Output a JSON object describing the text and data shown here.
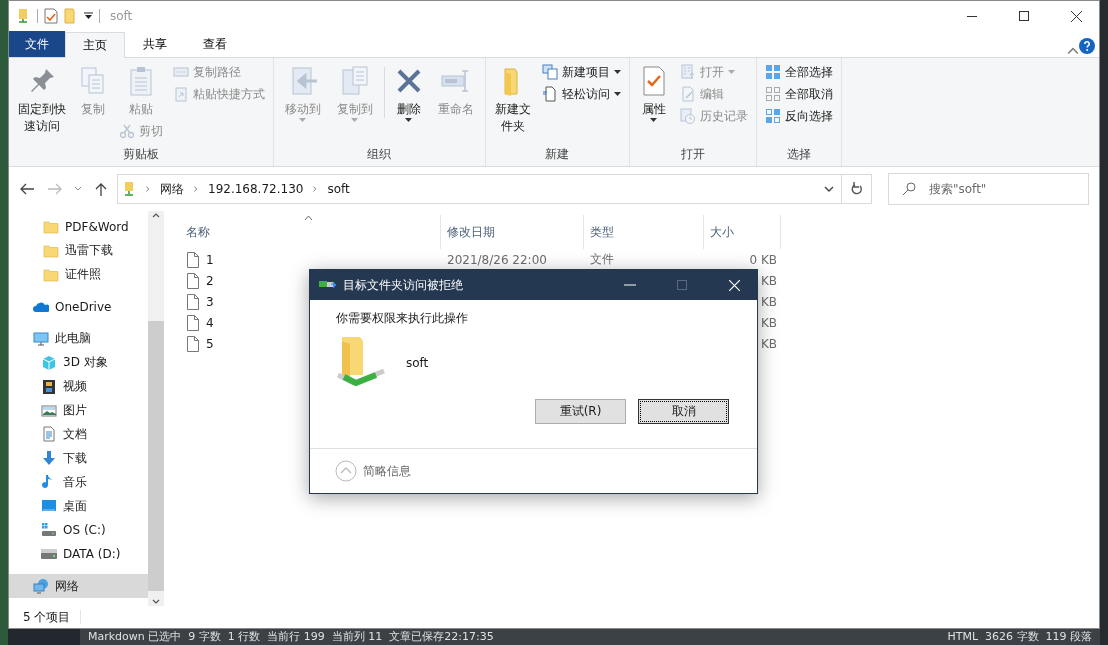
{
  "window": {
    "title": "soft"
  },
  "ribbon": {
    "file_tab": "文件",
    "tabs": [
      {
        "label": "主页",
        "selected": true
      },
      {
        "label": "共享",
        "selected": false
      },
      {
        "label": "查看",
        "selected": false
      }
    ],
    "groups": [
      {
        "label": "剪贴板",
        "columns": [
          [
            {
              "kind": "large",
              "label": "固定到快速访问",
              "disabled": false,
              "menu": false
            }
          ],
          [
            {
              "kind": "large",
              "label": "复制",
              "disabled": true,
              "menu": false
            }
          ],
          [
            {
              "kind": "large",
              "label": "粘贴",
              "disabled": true,
              "menu": false
            },
            {
              "kind": "small",
              "label": "剪切",
              "disabled": true,
              "menu": false
            }
          ],
          [
            {
              "kind": "small",
              "label": "复制路径",
              "disabled": true,
              "menu": false
            },
            {
              "kind": "small",
              "label": "粘贴快捷方式",
              "disabled": true,
              "menu": false
            }
          ]
        ]
      },
      {
        "label": "组织",
        "columns": [
          [
            {
              "kind": "large",
              "label": "移动到",
              "disabled": true,
              "menu": true
            }
          ],
          [
            {
              "kind": "large",
              "label": "复制到",
              "disabled": true,
              "menu": true
            }
          ],
          [
            {
              "kind": "large",
              "label": "删除",
              "disabled": false,
              "menu": true
            }
          ],
          [
            {
              "kind": "large",
              "label": "重命名",
              "disabled": true,
              "menu": false
            }
          ]
        ]
      },
      {
        "label": "新建",
        "columns": [
          [
            {
              "kind": "large",
              "label": "新建文件夹",
              "disabled": false,
              "menu": false
            }
          ],
          [
            {
              "kind": "small",
              "label": "新建项目",
              "disabled": false,
              "menu": true
            },
            {
              "kind": "small",
              "label": "轻松访问",
              "disabled": false,
              "menu": true
            }
          ]
        ]
      },
      {
        "label": "打开",
        "columns": [
          [
            {
              "kind": "large",
              "label": "属性",
              "disabled": false,
              "menu": true
            }
          ],
          [
            {
              "kind": "small",
              "label": "打开",
              "disabled": true,
              "menu": true
            },
            {
              "kind": "small",
              "label": "编辑",
              "disabled": true,
              "menu": false
            },
            {
              "kind": "small",
              "label": "历史记录",
              "disabled": true,
              "menu": false
            }
          ]
        ]
      },
      {
        "label": "选择",
        "columns": [
          [
            {
              "kind": "small",
              "label": "全部选择",
              "disabled": false,
              "menu": false
            },
            {
              "kind": "small",
              "label": "全部取消",
              "disabled": false,
              "menu": false
            },
            {
              "kind": "small",
              "label": "反向选择",
              "disabled": false,
              "menu": false
            }
          ]
        ]
      }
    ]
  },
  "address": {
    "crumbs": [
      "网络",
      "192.168.72.130",
      "soft"
    ]
  },
  "search": {
    "placeholder": "搜索\"soft\""
  },
  "sidebar": {
    "pinned": [
      {
        "label": "PDF&Word",
        "selected": false
      },
      {
        "label": "迅雷下载",
        "selected": false
      },
      {
        "label": "证件照",
        "selected": false
      }
    ],
    "items": [
      {
        "label": "OneDrive",
        "selected": false
      },
      {
        "label": "此电脑",
        "selected": false,
        "children": [
          {
            "label": "3D 对象",
            "selected": false
          },
          {
            "label": "视频",
            "selected": false
          },
          {
            "label": "图片",
            "selected": false
          },
          {
            "label": "文档",
            "selected": false
          },
          {
            "label": "下载",
            "selected": false
          },
          {
            "label": "音乐",
            "selected": false
          },
          {
            "label": "桌面",
            "selected": false
          },
          {
            "label": "OS (C:)",
            "selected": false
          },
          {
            "label": "DATA (D:)",
            "selected": false
          }
        ]
      },
      {
        "label": "网络",
        "selected": true
      }
    ]
  },
  "file_list": {
    "columns": [
      "名称",
      "修改日期",
      "类型",
      "大小"
    ],
    "rows": [
      {
        "name": "1",
        "modified": "2021/8/26 22:00",
        "type": "文件",
        "size": "0 KB"
      },
      {
        "name": "2",
        "size": "KB"
      },
      {
        "name": "3",
        "size": "KB"
      },
      {
        "name": "4",
        "size": "KB"
      },
      {
        "name": "5",
        "size": "KB"
      }
    ]
  },
  "status_bar": {
    "count": "5 个项目"
  },
  "dialog": {
    "title": "目标文件夹访问被拒绝",
    "message": "你需要权限来执行此操作",
    "item": "soft",
    "buttons": [
      {
        "label": "重试(R)",
        "focused": false
      },
      {
        "label": "取消",
        "focused": true
      }
    ],
    "details": "简略信息"
  },
  "editor_status_bar": {
    "left": "Markdown 已选中  9 字数  1 行数  当前行 199  当前列 11  文章已保存22:17:35",
    "right": "HTML  3626 字数  119 段落"
  }
}
